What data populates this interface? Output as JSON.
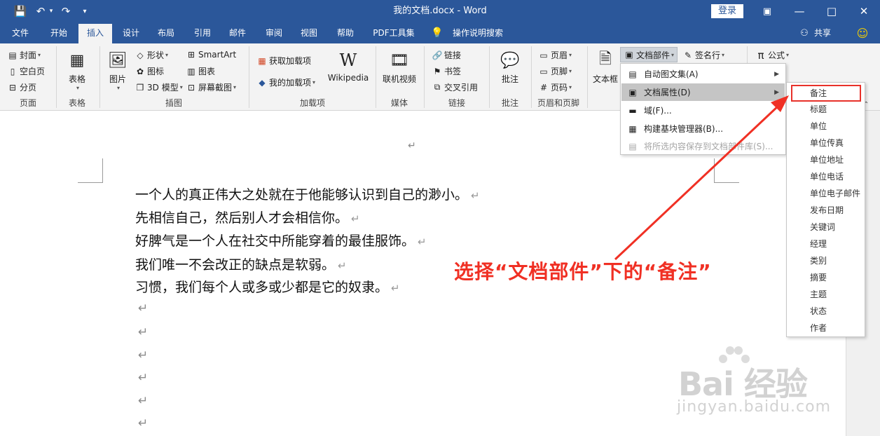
{
  "window": {
    "title": "我的文档.docx  -  Word",
    "signin": "登录",
    "minimize": "—",
    "restore": "□",
    "close": "✕",
    "ribbon_display": "▣"
  },
  "qat": {
    "save": "💾",
    "undo": "↶",
    "undo_caret": "▾",
    "redo": "↷",
    "customize": "▾"
  },
  "tabs": [
    "文件",
    "开始",
    "插入",
    "设计",
    "布局",
    "引用",
    "邮件",
    "审阅",
    "视图",
    "帮助",
    "PDF工具集",
    "操作说明搜索"
  ],
  "share": "共享",
  "ribbon": {
    "pages": {
      "cover": "封面",
      "blank": "空白页",
      "break": "分页",
      "label": "页面"
    },
    "tables": {
      "table": "表格",
      "label": "表格"
    },
    "illustrations": {
      "pictures": "图片",
      "shapes": "形状",
      "icons": "图标",
      "models3d": "3D 模型",
      "smartart": "SmartArt",
      "chart": "图表",
      "screenshot": "屏幕截图",
      "label": "插图"
    },
    "addins": {
      "get": "获取加载项",
      "my": "我的加载项",
      "wikipedia": "Wikipedia",
      "label": "加载项"
    },
    "media": {
      "video": "联机视频",
      "label": "媒体"
    },
    "links": {
      "link": "链接",
      "bookmark": "书签",
      "cross": "交叉引用",
      "label": "链接"
    },
    "comments": {
      "comment": "批注",
      "label": "批注"
    },
    "header_footer": {
      "header": "页眉",
      "footer": "页脚",
      "page_number": "页码",
      "label": "页眉和页脚"
    },
    "text": {
      "textbox": "文本框",
      "quick_parts": "文档部件",
      "signature": "签名行",
      "equation": "公式"
    }
  },
  "menu": {
    "items": [
      {
        "label": "自动图文集(A)",
        "has_sub": true
      },
      {
        "label": "文档属性(D)",
        "has_sub": true
      },
      {
        "label": "域(F)...",
        "has_sub": false
      },
      {
        "label": "构建基块管理器(B)...",
        "has_sub": false
      },
      {
        "label": "将所选内容保存到文档部件库(S)...",
        "has_sub": false
      }
    ]
  },
  "submenu": {
    "items": [
      "备注",
      "标题",
      "单位",
      "单位传真",
      "单位地址",
      "单位电话",
      "单位电子邮件",
      "发布日期",
      "关键词",
      "经理",
      "类别",
      "摘要",
      "主题",
      "状态",
      "作者"
    ]
  },
  "document": {
    "lines": [
      "一个人的真正伟大之处就在于他能够认识到自己的渺小。",
      "先相信自己，然后别人才会相信你。",
      "好脾气是一个人在社交中所能穿着的最佳服饰。",
      "我们唯一不会改正的缺点是软弱。",
      "习惯，我们每个人或多或少都是它的奴隶。"
    ],
    "paragraph_mark": "↵"
  },
  "annotation": "选择“文档部件”下的“备注”",
  "watermark": {
    "main": "Bai 经验",
    "sub": "jingyan.baidu.com"
  },
  "colors": {
    "brand": "#2b579a",
    "ribbon": "#f3f3f3",
    "annotation": "#f03024"
  }
}
